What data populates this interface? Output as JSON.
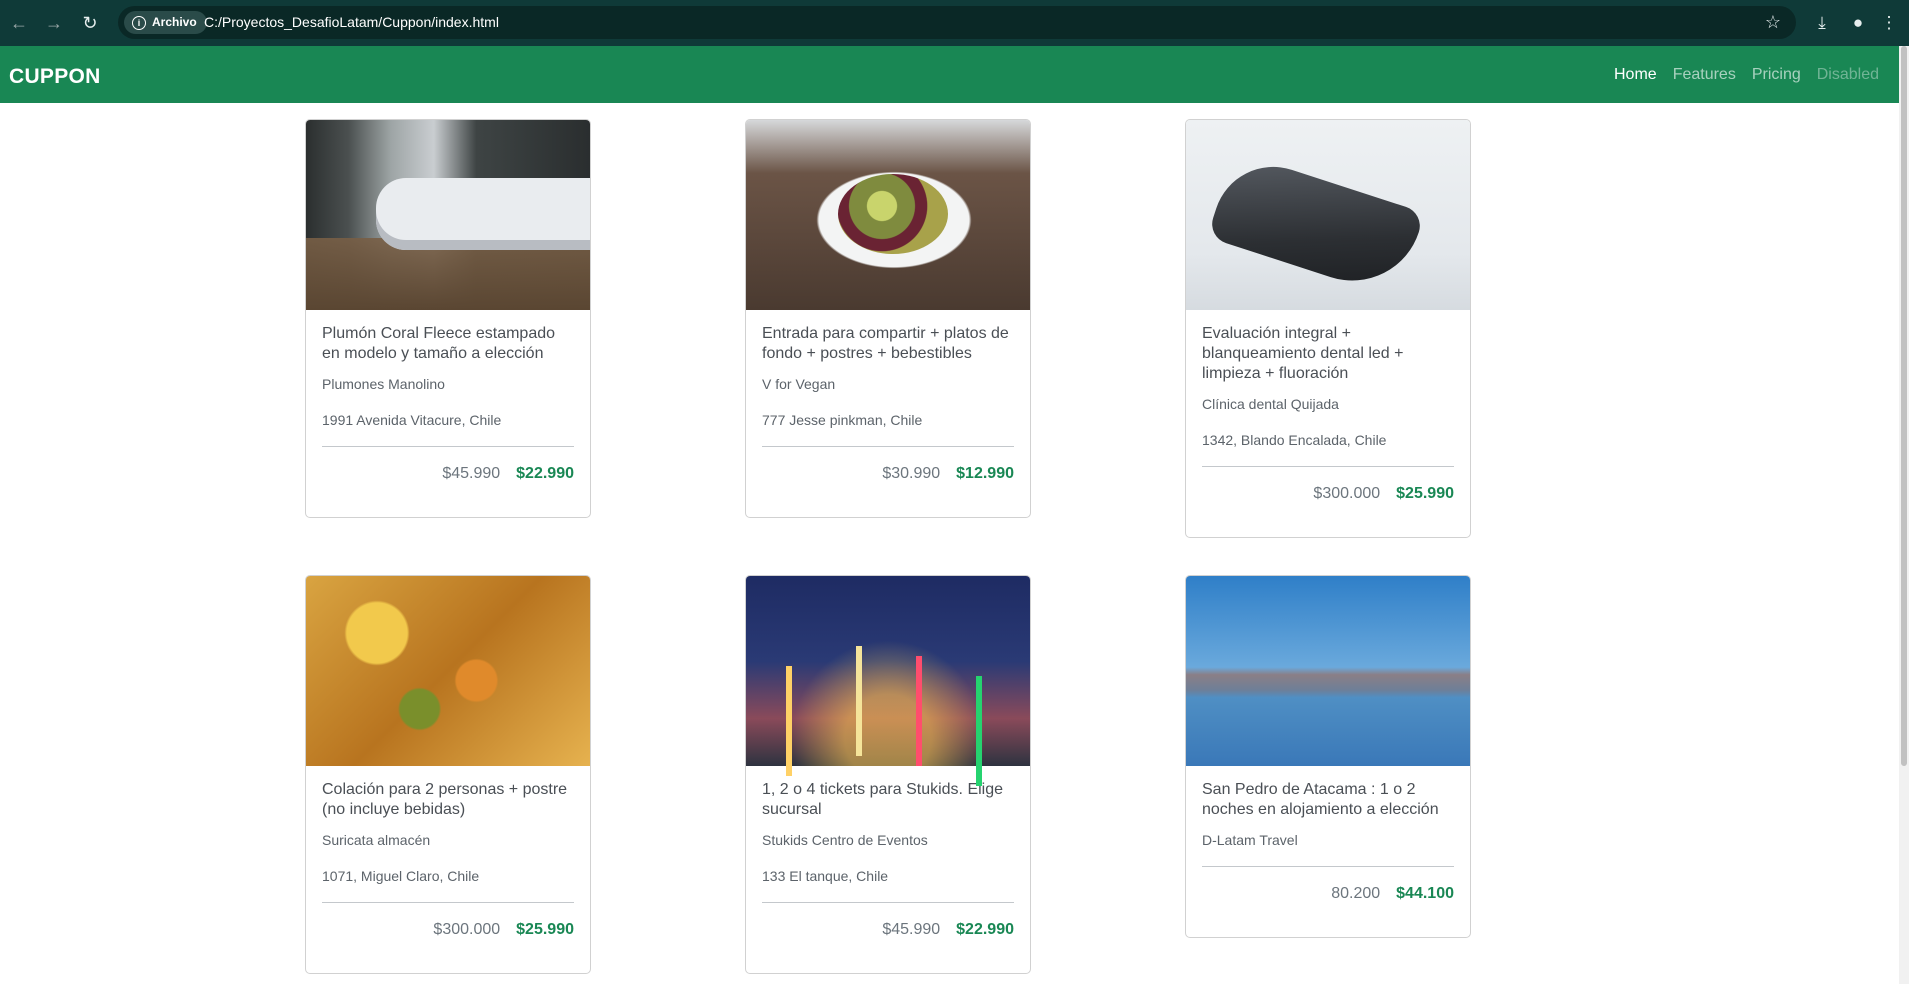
{
  "browser": {
    "site_info_label": "Archivo",
    "url": "C:/Proyectos_DesafioLatam/Cuppon/index.html"
  },
  "navbar": {
    "brand": "CUPPON",
    "links": [
      {
        "label": "Home",
        "state": "active"
      },
      {
        "label": "Features",
        "state": "normal"
      },
      {
        "label": "Pricing",
        "state": "normal"
      },
      {
        "label": "Disabled",
        "state": "disabled"
      }
    ]
  },
  "colors": {
    "navbar": "#198754",
    "price_new": "#198754",
    "chrome": "#0f3a38"
  },
  "cards": [
    {
      "title": "Plumón Coral Fleece estampado en modelo y tamaño a elección",
      "vendor": "Plumones Manolino",
      "address": "1991 Avenida Vitacure, Chile",
      "old_price": "$45.990",
      "new_price": "$22.990",
      "image": "bed-photo"
    },
    {
      "title": "Entrada para compartir + platos de fondo + postres + bebestibles",
      "vendor": "V for Vegan",
      "address": "777 Jesse pinkman, Chile",
      "old_price": "$30.990",
      "new_price": "$12.990",
      "image": "salad-photo"
    },
    {
      "title": "Evaluación integral + blanqueamiento dental led + limpieza + fluoración",
      "vendor": "Clínica dental Quijada",
      "address": "1342, Blando Encalada, Chile",
      "old_price": "$300.000",
      "new_price": "$25.990",
      "image": "dental-chair-photo"
    },
    {
      "title": "Colación para 2 personas + postre (no incluye bebidas)",
      "vendor": "Suricata almacén",
      "address": "1071, Miguel Claro, Chile",
      "old_price": "$300.000",
      "new_price": "$25.990",
      "image": "food-dish-photo"
    },
    {
      "title": "1, 2 o 4 tickets para Stukids. Elige sucursal",
      "vendor": "Stukids Centro de Eventos",
      "address": "133 El tanque, Chile",
      "old_price": "$45.990",
      "new_price": "$22.990",
      "image": "fair-photo"
    },
    {
      "title": "San Pedro de Atacama : 1 o 2 noches en alojamiento a elección",
      "vendor": "D-Latam Travel",
      "address": "",
      "old_price": "80.200",
      "new_price": "$44.100",
      "image": "atacama-photo"
    }
  ]
}
